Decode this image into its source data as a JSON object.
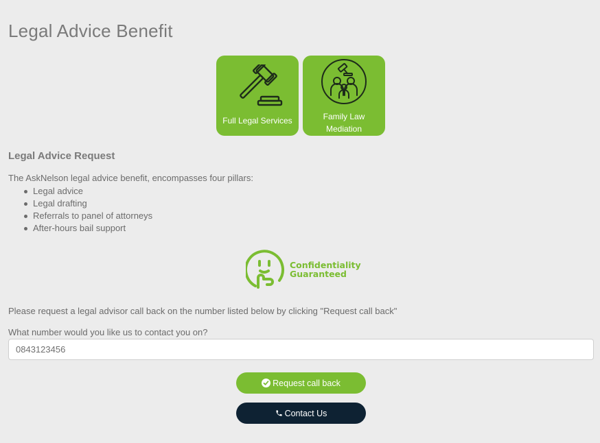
{
  "page": {
    "title": "Legal Advice Benefit"
  },
  "tiles": [
    {
      "label": "Full Legal Services",
      "icon": "gavel-icon"
    },
    {
      "label": "Family Law Mediation",
      "icon": "family-mediation-icon"
    }
  ],
  "request": {
    "title": "Legal Advice Request",
    "intro": "The AskNelson legal advice benefit, encompasses four pillars:",
    "pillars": [
      "Legal advice",
      "Legal drafting",
      "Referrals to panel of attorneys",
      "After-hours bail support"
    ]
  },
  "badge": {
    "line1": "Confidentiality",
    "line2": "Guaranteed",
    "icon": "shush-face-icon"
  },
  "callback": {
    "instruction": "Please request a legal advisor call back on the number listed below by clicking \"Request call back\"",
    "phone_label": "What number would you like us to contact you on?",
    "phone_value": "0843123456",
    "request_label": "Request call back",
    "contact_label": "Contact Us"
  },
  "colors": {
    "accent": "#7bbd32",
    "dark_button": "#0e2233",
    "background": "#ececec"
  }
}
